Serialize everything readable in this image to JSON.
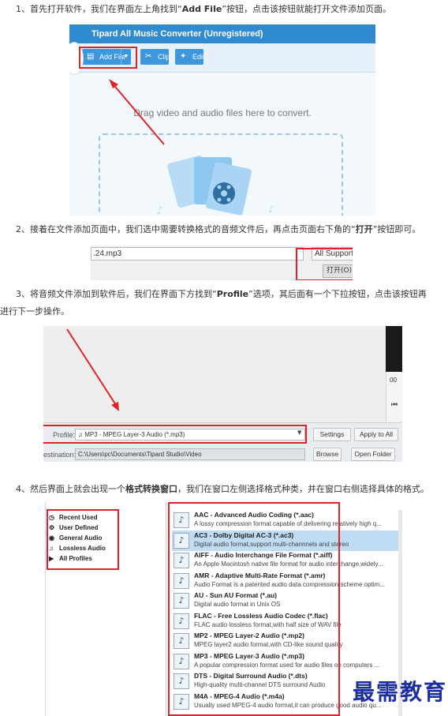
{
  "steps": [
    {
      "prefix": "1、首先打开软件，我们在界面左上角找到“",
      "bold": "Add File",
      "suffix": "”按钮，点击该按钮就能打开文件添加页面。"
    },
    {
      "prefix": "2、接着在文件添加页面中，我们选中需要转换格式的音频文件后，再点击页面右下角的“",
      "bold": "打开",
      "suffix": "”按钮即可。"
    },
    {
      "prefix": "3、将音频文件添加到软件后，我们在界面下方找到“",
      "bold": "Profile",
      "suffix": "”选项，其后面有一个下拉按钮，点击该按钮再",
      "line2": "进行下一步操作。"
    },
    {
      "prefix": "4、然后界面上就会出现一个",
      "bold": "格式转换窗口",
      "suffix": "，我们在窗口左侧选择格式种类，并在窗口右侧选择具体的格式。"
    }
  ],
  "shot1": {
    "title": "Tipard All Music Converter (Unregistered)",
    "add_file": "Add File",
    "clip": "Clip",
    "edit": "Edit",
    "drag_text": "Drag video and audio files here to convert."
  },
  "shot2": {
    "filename": ".24.mp3",
    "filetype": "All Supporte",
    "open_button": "打开(O)"
  },
  "shot3": {
    "side_value": "00",
    "profile_label": "Profile:",
    "profile_value": "MP3 - MPEG Layer-3 Audio (*.mp3)",
    "settings": "Settings",
    "apply_all": "Apply to All",
    "destination_label": "estination:",
    "destination_value": "C:\\Users\\pc\\Documents\\Tipard Studio\\Video",
    "browse": "Browse",
    "open_folder": "Open Folder"
  },
  "shot4": {
    "categories": [
      "Recent Used",
      "User Defined",
      "General Audio",
      "Lossless Audio",
      "All Profiles"
    ],
    "formats": [
      {
        "title": "AAC - Advanced Audio Coding (*.aac)",
        "desc": "A lossy compression format capable of delivering relatively high q..."
      },
      {
        "title": "AC3 - Dolby Digital AC-3 (*.ac3)",
        "desc": "Digital audio format,support multi-channnels and stereo"
      },
      {
        "title": "AIFF - Audio Interchange File Format (*.aiff)",
        "desc": "An Apple Macintosh native file format for audio interchange,widely..."
      },
      {
        "title": "AMR - Adaptive Multi-Rate Format (*.amr)",
        "desc": "Audio Format is a patented audio data compression scheme optim..."
      },
      {
        "title": "AU - Sun AU Format (*.au)",
        "desc": "Digital audio format in Unix OS"
      },
      {
        "title": "FLAC - Free Lossless Audio Codec (*.flac)",
        "desc": "FLAC audio lossless format,with half size of WAV file"
      },
      {
        "title": "MP2 - MPEG Layer-2 Audio (*.mp2)",
        "desc": "MPEG layer2 audio format,with CD-like sound quality"
      },
      {
        "title": "MP3 - MPEG Layer-3 Audio (*.mp3)",
        "desc": "A popular compression format used for audio files on computers ..."
      },
      {
        "title": "DTS - Digital Surround Audio (*.dts)",
        "desc": "High-quality multi-channel DTS surround Audio"
      },
      {
        "title": "M4A - MPEG-4 Audio (*.m4a)",
        "desc": "Usually used MPEG-4 audio format,it can produce good audio qu..."
      }
    ],
    "selected_index": 1
  },
  "watermark": "最需教育",
  "colors": {
    "highlight": "#e0222a",
    "titlebar": "#2f8ad0",
    "button": "#3d97dc",
    "selection": "#bfdcf3"
  }
}
